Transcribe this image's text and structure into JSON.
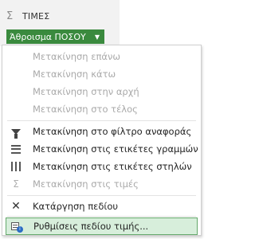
{
  "panel": {
    "values_area_label": "ΤΙΜΕΣ",
    "field_chip": "Άθροισμα ΠΟΣΟΥ"
  },
  "menu": {
    "items": [
      {
        "label": "Μετακίνηση επάνω",
        "disabled": true,
        "icon": "none"
      },
      {
        "label": "Μετακίνηση κάτω",
        "disabled": true,
        "icon": "none"
      },
      {
        "label": "Μετακίνηση στην αρχή",
        "disabled": true,
        "icon": "none"
      },
      {
        "label": "Μετακίνηση στο τέλος",
        "disabled": true,
        "icon": "none"
      },
      {
        "label": "Μετακίνηση στο φίλτρο αναφοράς",
        "disabled": false,
        "icon": "filter-icon"
      },
      {
        "label": "Μετακίνηση στις ετικέτες γραμμών",
        "disabled": false,
        "icon": "rows-icon"
      },
      {
        "label": "Μετακίνηση στις ετικέτες στηλών",
        "disabled": false,
        "icon": "columns-icon"
      },
      {
        "label": "Μετακίνηση στις τιμές",
        "disabled": true,
        "icon": "sigma-icon"
      },
      {
        "label": "Κατάργηση πεδίου",
        "disabled": false,
        "icon": "close-icon"
      },
      {
        "label": "Ρυθμίσεις πεδίου τιμής...",
        "disabled": false,
        "icon": "value-field-settings-icon"
      }
    ]
  },
  "colors": {
    "chip_bg": "#3a8a3e",
    "selected_bg": "#d7eedb",
    "selected_border": "#64a86b"
  }
}
